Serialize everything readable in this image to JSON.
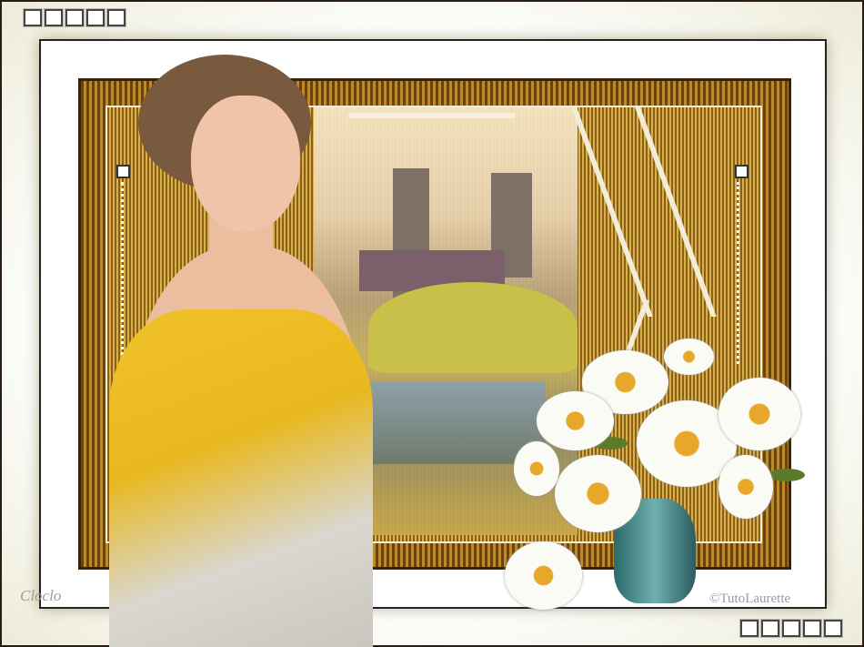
{
  "artwork": {
    "description_none": "",
    "watermark_left": "Cloclo",
    "copyright": "©TutoLaurette"
  },
  "colors": {
    "gold": "#b98a2e",
    "dark_brown": "#3b2308",
    "dress_yellow": "#f1c22a",
    "vase_teal": "#2a6a6c"
  }
}
